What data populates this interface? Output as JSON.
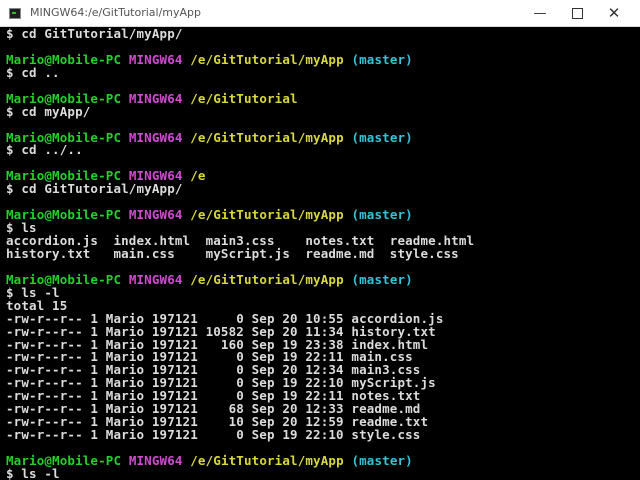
{
  "window": {
    "title": "MINGW64:/e/GitTutorial/myApp",
    "minimize": "—",
    "close": "✕"
  },
  "terminal": {
    "lines": [
      {
        "type": "cmd",
        "text": "$ cd GitTutorial/myApp/"
      },
      {
        "type": "blank",
        "text": ""
      },
      {
        "type": "prompt",
        "user": "Mario@Mobile-PC",
        "sys": "MINGW64",
        "path": "/e/GitTutorial/myApp",
        "branch": "(master)"
      },
      {
        "type": "cmd",
        "text": "$ cd .."
      },
      {
        "type": "blank",
        "text": ""
      },
      {
        "type": "prompt",
        "user": "Mario@Mobile-PC",
        "sys": "MINGW64",
        "path": "/e/GitTutorial",
        "branch": ""
      },
      {
        "type": "cmd",
        "text": "$ cd myApp/"
      },
      {
        "type": "blank",
        "text": ""
      },
      {
        "type": "prompt",
        "user": "Mario@Mobile-PC",
        "sys": "MINGW64",
        "path": "/e/GitTutorial/myApp",
        "branch": "(master)"
      },
      {
        "type": "cmd",
        "text": "$ cd ../.."
      },
      {
        "type": "blank",
        "text": ""
      },
      {
        "type": "prompt",
        "user": "Mario@Mobile-PC",
        "sys": "MINGW64",
        "path": "/e",
        "branch": ""
      },
      {
        "type": "cmd",
        "text": "$ cd GitTutorial/myApp/"
      },
      {
        "type": "blank",
        "text": ""
      },
      {
        "type": "prompt",
        "user": "Mario@Mobile-PC",
        "sys": "MINGW64",
        "path": "/e/GitTutorial/myApp",
        "branch": "(master)"
      },
      {
        "type": "cmd",
        "text": "$ ls"
      },
      {
        "type": "out",
        "text": "accordion.js  index.html  main3.css    notes.txt  readme.html"
      },
      {
        "type": "out",
        "text": "history.txt   main.css    myScript.js  readme.md  style.css"
      },
      {
        "type": "blank",
        "text": ""
      },
      {
        "type": "prompt",
        "user": "Mario@Mobile-PC",
        "sys": "MINGW64",
        "path": "/e/GitTutorial/myApp",
        "branch": "(master)"
      },
      {
        "type": "cmd",
        "text": "$ ls -l"
      },
      {
        "type": "out",
        "text": "total 15"
      },
      {
        "type": "out",
        "text": "-rw-r--r-- 1 Mario 197121     0 Sep 20 10:55 accordion.js"
      },
      {
        "type": "out",
        "text": "-rw-r--r-- 1 Mario 197121 10582 Sep 20 11:34 history.txt"
      },
      {
        "type": "out",
        "text": "-rw-r--r-- 1 Mario 197121   160 Sep 19 23:38 index.html"
      },
      {
        "type": "out",
        "text": "-rw-r--r-- 1 Mario 197121     0 Sep 19 22:11 main.css"
      },
      {
        "type": "out",
        "text": "-rw-r--r-- 1 Mario 197121     0 Sep 20 12:34 main3.css"
      },
      {
        "type": "out",
        "text": "-rw-r--r-- 1 Mario 197121     0 Sep 19 22:10 myScript.js"
      },
      {
        "type": "out",
        "text": "-rw-r--r-- 1 Mario 197121     0 Sep 19 22:11 notes.txt"
      },
      {
        "type": "out",
        "text": "-rw-r--r-- 1 Mario 197121    68 Sep 20 12:33 readme.md"
      },
      {
        "type": "out",
        "text": "-rw-r--r-- 1 Mario 197121    10 Sep 20 12:59 readme.txt"
      },
      {
        "type": "out",
        "text": "-rw-r--r-- 1 Mario 197121     0 Sep 19 22:10 style.css"
      },
      {
        "type": "blank",
        "text": ""
      },
      {
        "type": "prompt",
        "user": "Mario@Mobile-PC",
        "sys": "MINGW64",
        "path": "/e/GitTutorial/myApp",
        "branch": "(master)"
      },
      {
        "type": "cmd",
        "text": "$ ls -l"
      }
    ]
  },
  "colors": {
    "background": "#000000",
    "text": "#dcdcdc",
    "user": "#23d12a",
    "system": "#d14bd1",
    "path": "#d8d83a",
    "branch": "#35c4d6"
  },
  "icons": {
    "app": "terminal-app-icon",
    "minimize": "minimize-icon",
    "maximize": "maximize-icon",
    "close": "close-icon"
  }
}
